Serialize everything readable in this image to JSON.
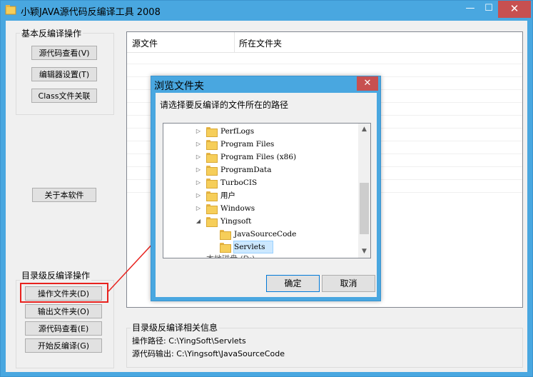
{
  "window": {
    "title": "小颖JAVA源代码反编译工具 2008",
    "minimize_glyph": "—",
    "maximize_glyph": "☐",
    "close_glyph": "✕"
  },
  "basic_group": {
    "title": "基本反编译操作",
    "buttons": [
      "源代码查看(V)",
      "编辑器设置(T)",
      "Class文件关联"
    ]
  },
  "about_button": "关于本软件",
  "dir_group": {
    "title": "目录级反编译操作",
    "buttons": [
      "操作文件夹(D)",
      "输出文件夹(O)",
      "源代码查看(E)",
      "开始反编译(G)"
    ]
  },
  "list": {
    "columns": [
      "源文件",
      "所在文件夹"
    ]
  },
  "info": {
    "title": "目录级反编译相关信息",
    "operation_path": "操作路径: C:\\YingSoft\\Servlets",
    "source_output": "源代码输出: C:\\Yingsoft\\JavaSourceCode"
  },
  "dialog": {
    "title": "浏览文件夹",
    "close_glyph": "✕",
    "prompt": "请选择要反编译的文件所在的路径",
    "tree": [
      {
        "label": "PerfLogs",
        "expander": "▷",
        "depth": 0
      },
      {
        "label": "Program Files",
        "expander": "▷",
        "depth": 0
      },
      {
        "label": "Program Files (x86)",
        "expander": "▷",
        "depth": 0
      },
      {
        "label": "ProgramData",
        "expander": "▷",
        "depth": 0
      },
      {
        "label": "TurboCIS",
        "expander": "▷",
        "depth": 0
      },
      {
        "label": "用户",
        "expander": "▷",
        "depth": 0
      },
      {
        "label": "Windows",
        "expander": "▷",
        "depth": 0
      },
      {
        "label": "Yingsoft",
        "expander": "◢",
        "depth": 0
      },
      {
        "label": "JavaSourceCode",
        "expander": "",
        "depth": 1
      },
      {
        "label": "Servlets",
        "expander": "",
        "depth": 1,
        "selected": true
      }
    ],
    "partial_row": "本地磁盘 (D:)",
    "scroll_up": "▲",
    "scroll_down": "▼",
    "ok": "确定",
    "cancel": "取消"
  },
  "colors": {
    "title_bar": "#49a7e0",
    "close": "#c75050",
    "highlight": "#e8221e",
    "selection": "#cce8ff"
  }
}
